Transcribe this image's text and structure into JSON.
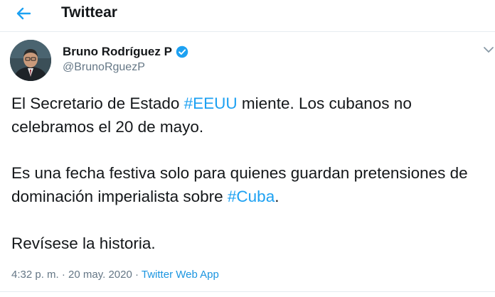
{
  "header": {
    "title": "Twittear",
    "back_icon": "arrow-left-icon"
  },
  "tweet": {
    "author": {
      "name": "Bruno Rodríguez P",
      "handle": "@BrunoRguezP",
      "verified": true,
      "avatar": "avatar-photo"
    },
    "body": {
      "p1_pre": "El Secretario de Estado ",
      "p1_tag": "#EEUU",
      "p1_post": " miente. Los cubanos no celebramos el 20 de mayo.",
      "p2_pre": "Es una fecha festiva solo para quienes guardan pretensiones de dominación imperialista sobre ",
      "p2_tag": "#Cuba",
      "p2_post": ".",
      "p3": "Revísese la historia."
    },
    "meta": {
      "time": "4:32 p. m.",
      "separator1": " · ",
      "date": "20 may. 2020",
      "separator2": " · ",
      "app": "Twitter Web App"
    }
  },
  "colors": {
    "accent": "#1da1f2",
    "secondary_text": "#657786",
    "primary_text": "#14171a"
  }
}
